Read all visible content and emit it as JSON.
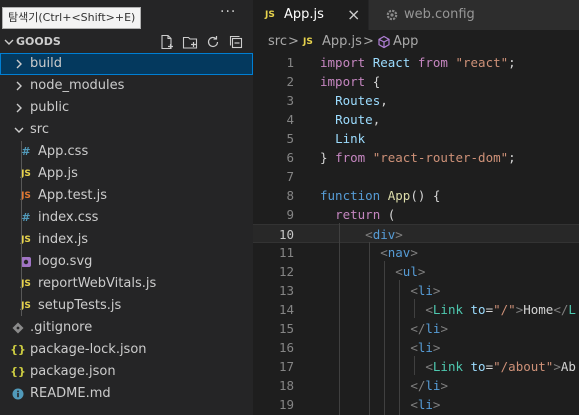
{
  "explorer": {
    "title": "탐색기(Ctrl+<Shift>+E)",
    "more": "···",
    "section_name": "GOODS",
    "actions": [
      "new-file-icon",
      "new-folder-icon",
      "refresh-icon",
      "collapse-all-icon"
    ],
    "items": [
      {
        "label": "build",
        "kind": "folder",
        "expanded": false,
        "depth": 0,
        "selected": true
      },
      {
        "label": "node_modules",
        "kind": "folder",
        "expanded": false,
        "depth": 0
      },
      {
        "label": "public",
        "kind": "folder",
        "expanded": false,
        "depth": 0
      },
      {
        "label": "src",
        "kind": "folder",
        "expanded": true,
        "depth": 0
      },
      {
        "label": "App.css",
        "kind": "css",
        "depth": 1
      },
      {
        "label": "App.js",
        "kind": "js",
        "depth": 1
      },
      {
        "label": "App.test.js",
        "kind": "test",
        "depth": 1
      },
      {
        "label": "index.css",
        "kind": "css",
        "depth": 1
      },
      {
        "label": "index.js",
        "kind": "js",
        "depth": 1
      },
      {
        "label": "logo.svg",
        "kind": "svg",
        "depth": 1
      },
      {
        "label": "reportWebVitals.js",
        "kind": "js",
        "depth": 1
      },
      {
        "label": "setupTests.js",
        "kind": "js",
        "depth": 1
      },
      {
        "label": ".gitignore",
        "kind": "git",
        "depth": 0
      },
      {
        "label": "package-lock.json",
        "kind": "json",
        "depth": 0
      },
      {
        "label": "package.json",
        "kind": "json",
        "depth": 0
      },
      {
        "label": "README.md",
        "kind": "info",
        "depth": 0
      }
    ]
  },
  "tabs": [
    {
      "label": "App.js",
      "badge": "JS",
      "active": true,
      "close": "×"
    },
    {
      "label": "web.config",
      "icon": "gear-icon",
      "active": false
    }
  ],
  "breadcrumb": {
    "folder": "src",
    "sep": ">",
    "file": "App.js",
    "file_badge": "JS",
    "symbol": "App"
  },
  "editor": {
    "current_line": 10,
    "lines": [
      {
        "n": "1",
        "t": [
          [
            "kw",
            "import "
          ],
          [
            "id",
            "React "
          ],
          [
            "kw",
            "from "
          ],
          [
            "str",
            "\"react\""
          ],
          [
            "txt",
            ";"
          ]
        ]
      },
      {
        "n": "2",
        "t": [
          [
            "kw",
            "import "
          ],
          [
            "txt",
            "{"
          ]
        ]
      },
      {
        "n": "3",
        "t": [
          [
            "txt",
            "  "
          ],
          [
            "id",
            "Routes"
          ],
          [
            "txt",
            ","
          ]
        ]
      },
      {
        "n": "4",
        "t": [
          [
            "txt",
            "  "
          ],
          [
            "id",
            "Route"
          ],
          [
            "txt",
            ","
          ]
        ]
      },
      {
        "n": "5",
        "t": [
          [
            "txt",
            "  "
          ],
          [
            "id",
            "Link"
          ]
        ]
      },
      {
        "n": "6",
        "t": [
          [
            "txt",
            "} "
          ],
          [
            "kw",
            "from "
          ],
          [
            "str",
            "\"react-router-dom\""
          ],
          [
            "txt",
            ";"
          ]
        ]
      },
      {
        "n": "7",
        "t": []
      },
      {
        "n": "8",
        "t": [
          [
            "fn",
            "function "
          ],
          [
            "fnm",
            "App"
          ],
          [
            "txt",
            "() {"
          ]
        ]
      },
      {
        "n": "9",
        "t": [
          [
            "txt",
            "  "
          ],
          [
            "kw",
            "return "
          ],
          [
            "txt",
            "("
          ]
        ]
      },
      {
        "n": "10",
        "t": [
          [
            "txt",
            "      "
          ],
          [
            "pun",
            "<"
          ],
          [
            "tag",
            "div"
          ],
          [
            "pun",
            ">"
          ]
        ]
      },
      {
        "n": "11",
        "t": [
          [
            "txt",
            "        "
          ],
          [
            "pun",
            "<"
          ],
          [
            "tag",
            "nav"
          ],
          [
            "pun",
            ">"
          ]
        ]
      },
      {
        "n": "12",
        "t": [
          [
            "txt",
            "          "
          ],
          [
            "pun",
            "<"
          ],
          [
            "tag",
            "ul"
          ],
          [
            "pun",
            ">"
          ]
        ]
      },
      {
        "n": "13",
        "t": [
          [
            "txt",
            "            "
          ],
          [
            "pun",
            "<"
          ],
          [
            "tag",
            "li"
          ],
          [
            "pun",
            ">"
          ]
        ]
      },
      {
        "n": "14",
        "t": [
          [
            "txt",
            "              "
          ],
          [
            "pun",
            "<"
          ],
          [
            "ty",
            "Link "
          ],
          [
            "at",
            "to"
          ],
          [
            "txt",
            "="
          ],
          [
            "str",
            "\"/\""
          ],
          [
            "pun",
            ">"
          ],
          [
            "txt",
            "Home"
          ],
          [
            "pun",
            "</"
          ],
          [
            "ty",
            "L"
          ]
        ]
      },
      {
        "n": "15",
        "t": [
          [
            "txt",
            "            "
          ],
          [
            "pun",
            "</"
          ],
          [
            "tag",
            "li"
          ],
          [
            "pun",
            ">"
          ]
        ]
      },
      {
        "n": "16",
        "t": [
          [
            "txt",
            "            "
          ],
          [
            "pun",
            "<"
          ],
          [
            "tag",
            "li"
          ],
          [
            "pun",
            ">"
          ]
        ]
      },
      {
        "n": "17",
        "t": [
          [
            "txt",
            "              "
          ],
          [
            "pun",
            "<"
          ],
          [
            "ty",
            "Link "
          ],
          [
            "at",
            "to"
          ],
          [
            "txt",
            "="
          ],
          [
            "str",
            "\"/about\""
          ],
          [
            "pun",
            ">"
          ],
          [
            "txt",
            "Ab"
          ]
        ]
      },
      {
        "n": "18",
        "t": [
          [
            "txt",
            "            "
          ],
          [
            "pun",
            "</"
          ],
          [
            "tag",
            "li"
          ],
          [
            "pun",
            ">"
          ]
        ]
      },
      {
        "n": "19",
        "t": [
          [
            "txt",
            "            "
          ],
          [
            "pun",
            "<"
          ],
          [
            "tag",
            "li"
          ],
          [
            "pun",
            ">"
          ]
        ]
      }
    ]
  },
  "colors": {
    "accent": "#007fd4",
    "selection": "#04395e",
    "js_badge": "#e8d44d",
    "css_hash": "#519aba",
    "svg": "#c586c0",
    "json": "#cbcb41",
    "git": "#8a8a8a"
  }
}
